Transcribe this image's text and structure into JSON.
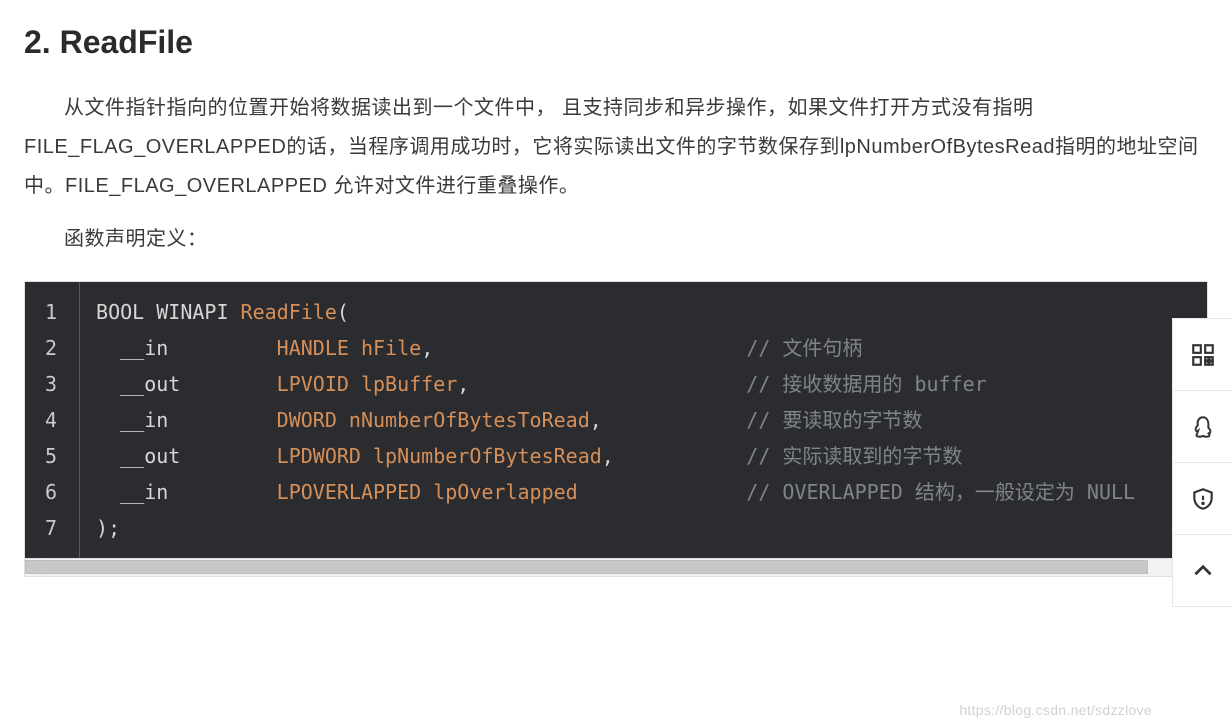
{
  "section": {
    "heading": "2. ReadFile",
    "para1": "从文件指针指向的位置开始将数据读出到一个文件中， 且支持同步和异步操作，如果文件打开方式没有指明FILE_FLAG_OVERLAPPED的话，当程序调用成功时，它将实际读出文件的字节数保存到lpNumberOfBytesRead指明的地址空间中。FILE_FLAG_OVERLAPPED 允许对文件进行重叠操作。",
    "para2": "函数声明定义："
  },
  "code": {
    "line_numbers": [
      "1",
      "2",
      "3",
      "4",
      "5",
      "6",
      "7"
    ],
    "lines": [
      {
        "pre": "BOOL WINAPI ",
        "fn": "ReadFile",
        "post": "(",
        "comment": ""
      },
      {
        "pre": "  __in         ",
        "type": "HANDLE ",
        "param": "hFile",
        "post": ",",
        "comment": "// 文件句柄"
      },
      {
        "pre": "  __out        ",
        "type": "LPVOID ",
        "param": "lpBuffer",
        "post": ",",
        "comment": "// 接收数据用的 buffer"
      },
      {
        "pre": "  __in         ",
        "type": "DWORD ",
        "param": "nNumberOfBytesToRead",
        "post": ",",
        "comment": "// 要读取的字节数"
      },
      {
        "pre": "  __out        ",
        "type": "LPDWORD ",
        "param": "lpNumberOfBytesRead",
        "post": ",",
        "comment": "// 实际读取到的字节数"
      },
      {
        "pre": "  __in         ",
        "type": "LPOVERLAPPED ",
        "param": "lpOverlapped",
        "post": "",
        "comment": "// OVERLAPPED 结构，一般设定为 NULL"
      },
      {
        "pre": ");",
        "type": "",
        "param": "",
        "post": "",
        "comment": ""
      }
    ],
    "comment_col": 54
  },
  "sidebar": {
    "items": [
      {
        "name": "qr-code-icon"
      },
      {
        "name": "penguin-icon"
      },
      {
        "name": "shield-icon"
      },
      {
        "name": "chevron-up-icon"
      }
    ]
  },
  "watermark": "https://blog.csdn.net/sdzzlove"
}
